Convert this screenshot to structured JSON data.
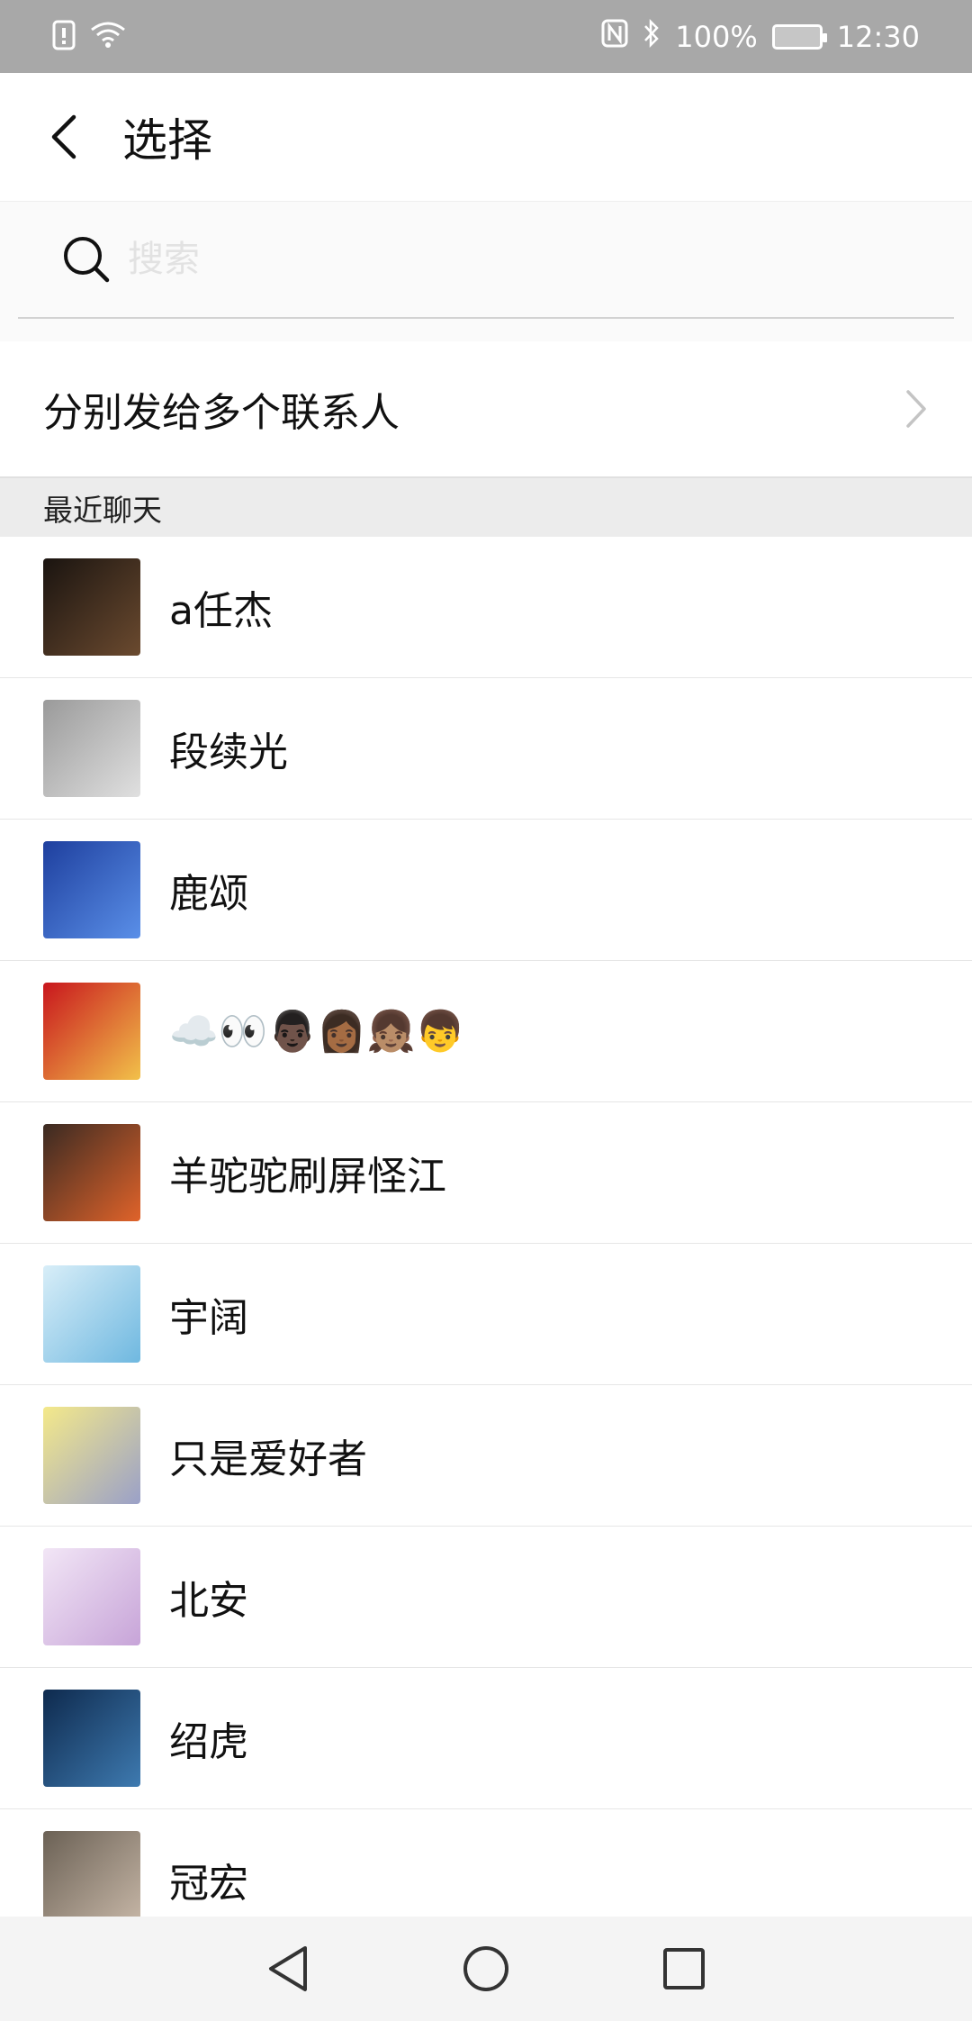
{
  "status_bar": {
    "battery_percent": "100%",
    "time": "12:30",
    "icons": [
      "sim-alert-icon",
      "wifi-icon",
      "nfc-icon",
      "bluetooth-icon",
      "battery-icon"
    ]
  },
  "header": {
    "title": "选择",
    "back_icon": "chevron-left-icon"
  },
  "search": {
    "placeholder": "搜索",
    "value": ""
  },
  "multi_send": {
    "label": "分别发给多个联系人"
  },
  "section": {
    "recent_label": "最近聊天"
  },
  "contacts": [
    {
      "name": "a任杰",
      "avatar_colors": [
        "#1a1410",
        "#6b4a2f"
      ]
    },
    {
      "name": "段续光",
      "avatar_colors": [
        "#9a9a9a",
        "#e0e0e0"
      ]
    },
    {
      "name": "鹿颂",
      "avatar_colors": [
        "#1e3f9e",
        "#5a8fe8"
      ]
    },
    {
      "name": "☁️👀👨🏿👩🏾👧🏽👦",
      "avatar_colors": [
        "#c8161d",
        "#f2c14a"
      ]
    },
    {
      "name": "羊驼驼刷屏怪江",
      "avatar_colors": [
        "#3a2a22",
        "#e0632a"
      ]
    },
    {
      "name": "宇阔",
      "avatar_colors": [
        "#d8eef8",
        "#6fb8e0"
      ]
    },
    {
      "name": "只是爱好者",
      "avatar_colors": [
        "#f4e98a",
        "#9aa0c8"
      ]
    },
    {
      "name": "北安",
      "avatar_colors": [
        "#f2e6f6",
        "#c7a4d8"
      ]
    },
    {
      "name": "绍虎",
      "avatar_colors": [
        "#0e2a4e",
        "#3e7ab0"
      ]
    },
    {
      "name": "冠宏",
      "avatar_colors": [
        "#6b6155",
        "#c8b8a8"
      ]
    }
  ],
  "nav": {
    "icons": [
      "back-triangle-icon",
      "home-circle-icon",
      "recents-square-icon"
    ]
  }
}
